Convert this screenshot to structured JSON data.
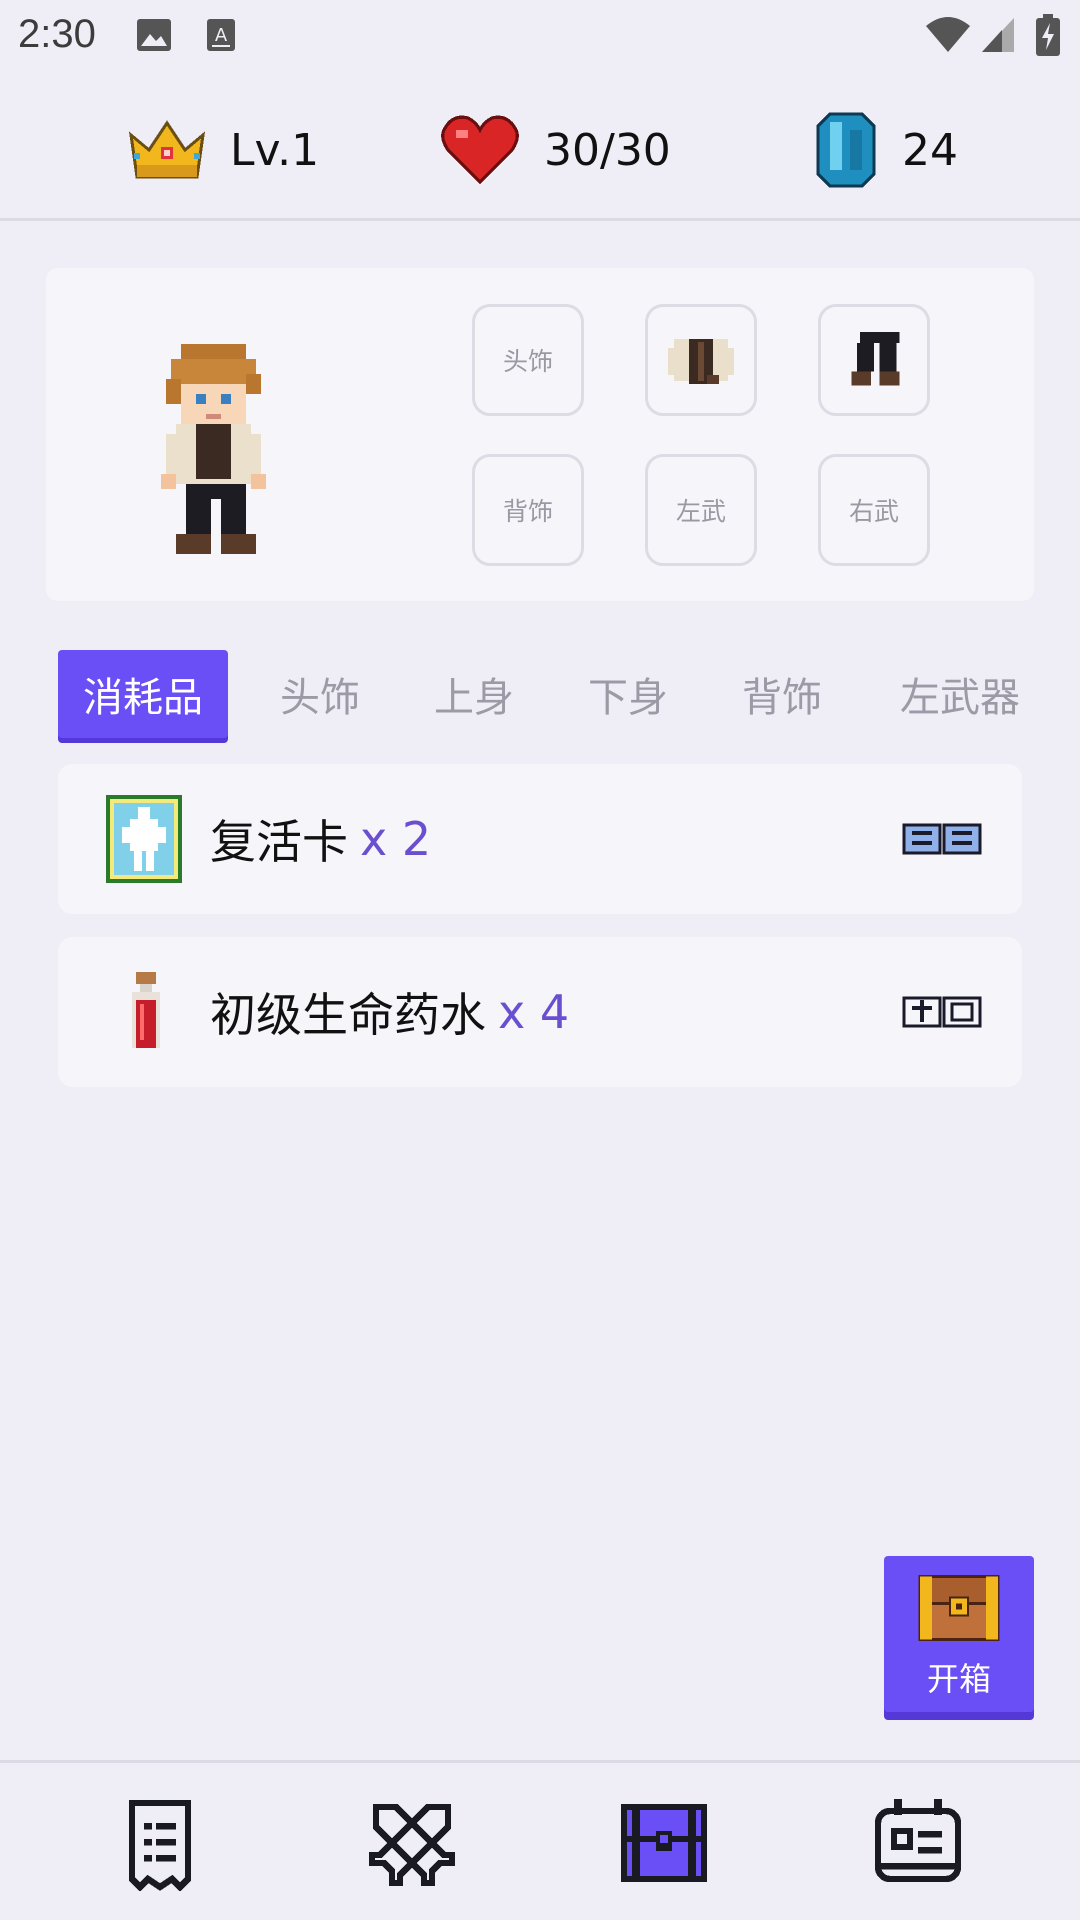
{
  "status_bar": {
    "time": "2:30",
    "icons": [
      "image-icon",
      "a11y-text-icon",
      "wifi-icon",
      "signal-icon",
      "battery-icon"
    ]
  },
  "stats": {
    "level": "Lv.1",
    "hp": "30/30",
    "gems": "24"
  },
  "equipment": {
    "slots": [
      {
        "label": "头饰",
        "equipped": false
      },
      {
        "label": "",
        "equipped": true,
        "item": "jacket"
      },
      {
        "label": "",
        "equipped": true,
        "item": "pants"
      },
      {
        "label": "背饰",
        "equipped": false
      },
      {
        "label": "左武",
        "equipped": false
      },
      {
        "label": "右武",
        "equipped": false
      }
    ]
  },
  "tabs": [
    {
      "label": "消耗品",
      "active": true
    },
    {
      "label": "头饰",
      "active": false
    },
    {
      "label": "上身",
      "active": false
    },
    {
      "label": "下身",
      "active": false
    },
    {
      "label": "背饰",
      "active": false
    },
    {
      "label": "左武器",
      "active": false
    }
  ],
  "items": [
    {
      "name": "复活卡",
      "count": "x 2",
      "action_icon": "scroll-pixel-icon"
    },
    {
      "name": "初级生命药水",
      "count": "x 4",
      "action_icon": "use-pixel-icon"
    }
  ],
  "open_chest": {
    "label": "开箱"
  },
  "bottom_nav": {
    "items": [
      {
        "icon": "task-list-icon",
        "active": false
      },
      {
        "icon": "crossed-swords-icon",
        "active": false
      },
      {
        "icon": "chest-icon",
        "active": true
      },
      {
        "icon": "character-card-icon",
        "active": false
      }
    ]
  },
  "colors": {
    "accent": "#6a4ff7",
    "background": "#efedf6",
    "card": "#f6f5fa",
    "count_text": "#6a4fd0"
  }
}
